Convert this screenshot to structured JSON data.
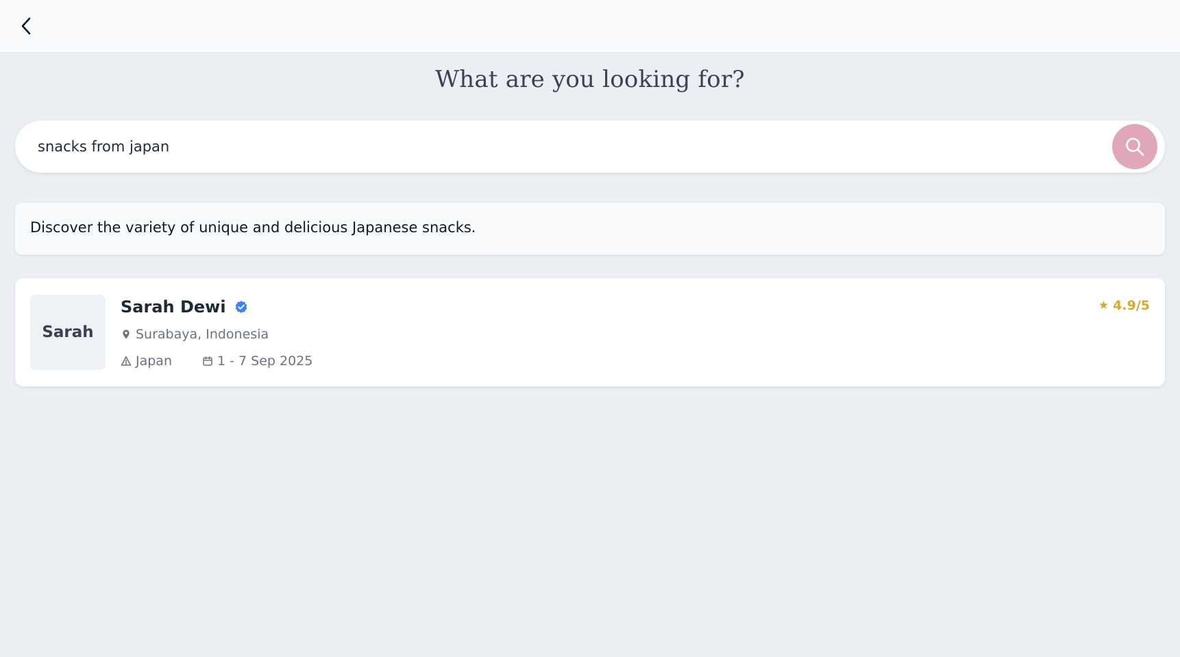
{
  "header": {
    "back_label": "Back"
  },
  "page": {
    "title": "What are you looking for?"
  },
  "search": {
    "value": "snacks from japan",
    "placeholder": ""
  },
  "description": {
    "text": "Discover the variety of unique and delicious Japanese snacks."
  },
  "results": [
    {
      "avatar_text": "Sarah",
      "name": "Sarah Dewi",
      "verified": true,
      "rating": "4.9/5",
      "location": "Surabaya, Indonesia",
      "destination": "Japan",
      "dates": "1 - 7 Sep 2025"
    }
  ],
  "icons": {
    "back": "chevron-left-icon",
    "search": "search-icon",
    "verified": "verified-badge-icon",
    "star": "star-icon",
    "location": "map-pin-icon",
    "destination": "triangle-icon",
    "dates": "calendar-icon"
  },
  "colors": {
    "background": "#ebeff3",
    "search_button": "#dfa7b9",
    "verified": "#3b82f6",
    "rating": "#d9a92b",
    "meta_text": "#6b7280"
  }
}
